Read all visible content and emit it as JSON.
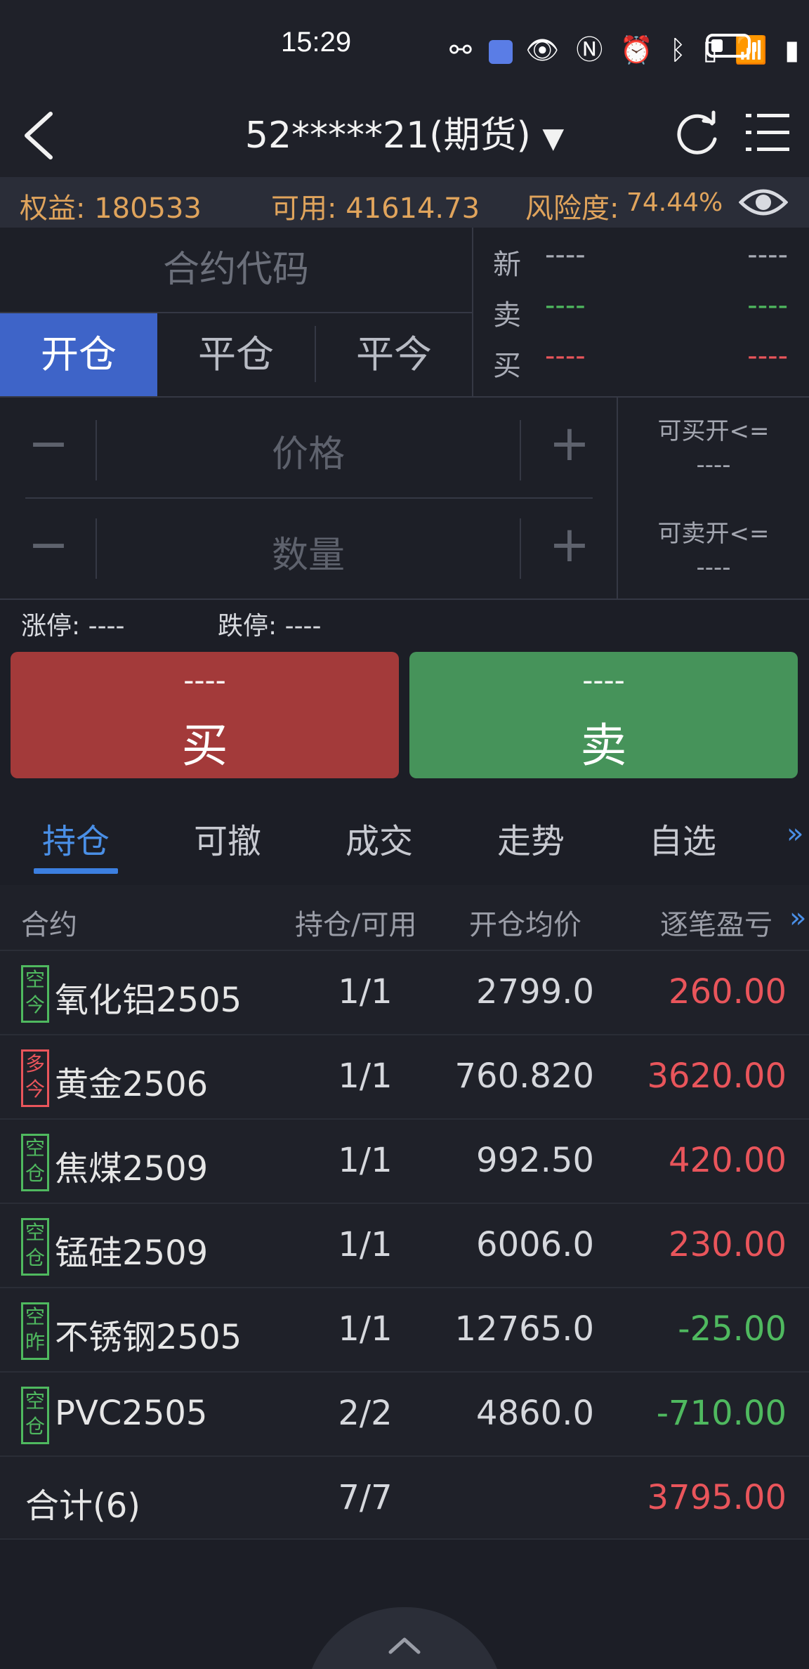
{
  "status_bar": {
    "time": "15:29",
    "icons": [
      "link-icon",
      "app-icon",
      "eye-icon",
      "nfc-icon",
      "alarm-icon",
      "bluetooth-icon",
      "vibrate-icon",
      "wifi-icon",
      "5g-signal-icon",
      "battery-icon"
    ]
  },
  "header": {
    "title": "52*****21(期货)"
  },
  "account": {
    "equity": "权益: 180533",
    "available": "可用: 41614.73",
    "risk_label": "风险度:",
    "risk_value": "74.44%"
  },
  "order": {
    "contract_placeholder": "合约代码",
    "tabs": [
      "开仓",
      "平仓",
      "平今"
    ],
    "quote": [
      {
        "label": "新",
        "v1": "----",
        "v2": "----"
      },
      {
        "label": "卖",
        "v1": "----",
        "v2": "----"
      },
      {
        "label": "买",
        "v1": "----",
        "v2": "----"
      }
    ],
    "price_placeholder": "价格",
    "qty_placeholder": "数量",
    "minus": "−",
    "plus": "+",
    "can_buy_label": "可买开<=",
    "can_buy_value": "----",
    "can_sell_label": "可卖开<=",
    "can_sell_value": "----",
    "limit_up": "涨停: ----",
    "limit_down": "跌停: ----",
    "buy_price": "----",
    "buy_label": "买",
    "sell_price": "----",
    "sell_label": "卖"
  },
  "bottom_tabs": [
    "持仓",
    "可撤",
    "成交",
    "走势",
    "自选"
  ],
  "table": {
    "headers": {
      "contract": "合约",
      "position": "持仓/可用",
      "avg_price": "开仓均价",
      "pnl": "逐笔盈亏"
    },
    "rows": [
      {
        "tag": "空今",
        "tag_color": "green",
        "name": "氧化铝2505",
        "pos": "1/1",
        "avg": "2799.0",
        "pnl": "260.00",
        "pnl_color": "red"
      },
      {
        "tag": "多今",
        "tag_color": "red",
        "name": "黄金2506",
        "pos": "1/1",
        "avg": "760.820",
        "pnl": "3620.00",
        "pnl_color": "red"
      },
      {
        "tag": "空仓",
        "tag_color": "green",
        "name": "焦煤2509",
        "pos": "1/1",
        "avg": "992.50",
        "pnl": "420.00",
        "pnl_color": "red"
      },
      {
        "tag": "空仓",
        "tag_color": "green",
        "name": "锰硅2509",
        "pos": "1/1",
        "avg": "6006.0",
        "pnl": "230.00",
        "pnl_color": "red"
      },
      {
        "tag": "空昨",
        "tag_color": "green",
        "name": "不锈钢2505",
        "pos": "1/1",
        "avg": "12765.0",
        "pnl": "-25.00",
        "pnl_color": "green"
      },
      {
        "tag": "空仓",
        "tag_color": "green",
        "name": "PVC2505",
        "pos": "2/2",
        "avg": "4860.0",
        "pnl": "-710.00",
        "pnl_color": "green"
      }
    ],
    "total": {
      "label": "合计(6)",
      "pos": "7/7",
      "pnl": "3795.00"
    }
  },
  "colors": {
    "accent": "#3e64c8",
    "buy": "#a33a3a",
    "sell": "#46935a",
    "profit": "#e9555b",
    "loss": "#4fb95f"
  }
}
